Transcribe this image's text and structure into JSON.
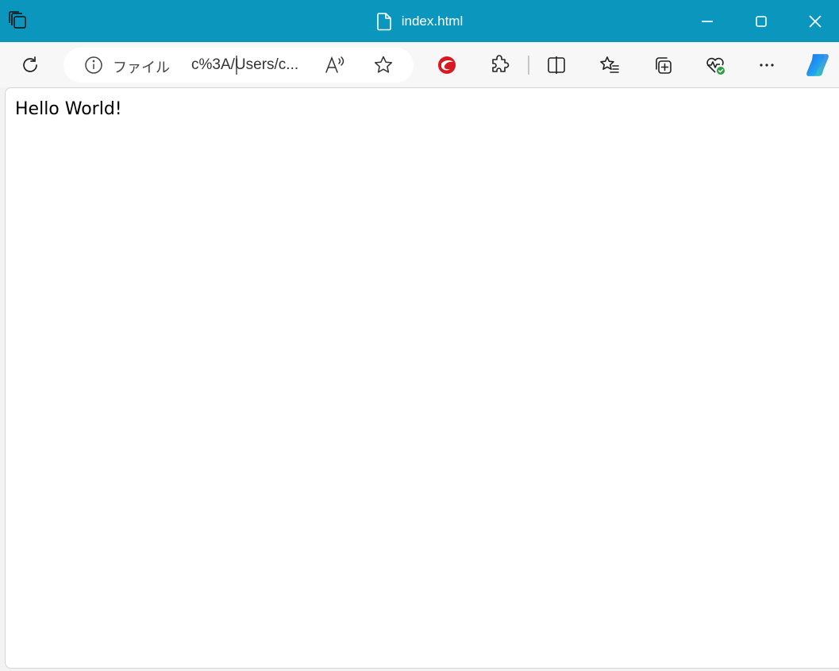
{
  "window": {
    "title": "index.html"
  },
  "address_bar": {
    "scheme_label": "ファイル",
    "url_display": "c%3A/Users/c..."
  },
  "page": {
    "content_text": "Hello World!"
  },
  "icons": {
    "tab_actions": "tab-actions-icon",
    "file": "file-icon",
    "minimize": "minimize-icon",
    "maximize": "maximize-icon",
    "close": "close-icon",
    "refresh": "refresh-icon",
    "info": "info-icon",
    "read_aloud": "read-aloud-icon",
    "favorite": "star-icon",
    "trend_micro": "trend-micro-icon",
    "extensions": "extensions-icon",
    "split_screen": "split-screen-icon",
    "favorites": "favorites-icon",
    "collections": "collections-icon",
    "browser_essentials": "browser-essentials-icon",
    "more": "more-icon",
    "copilot": "copilot-icon"
  },
  "colors": {
    "titlebar": "#0a96bd",
    "trend_micro_red": "#d71920",
    "essentials_green": "#2e9e44"
  }
}
